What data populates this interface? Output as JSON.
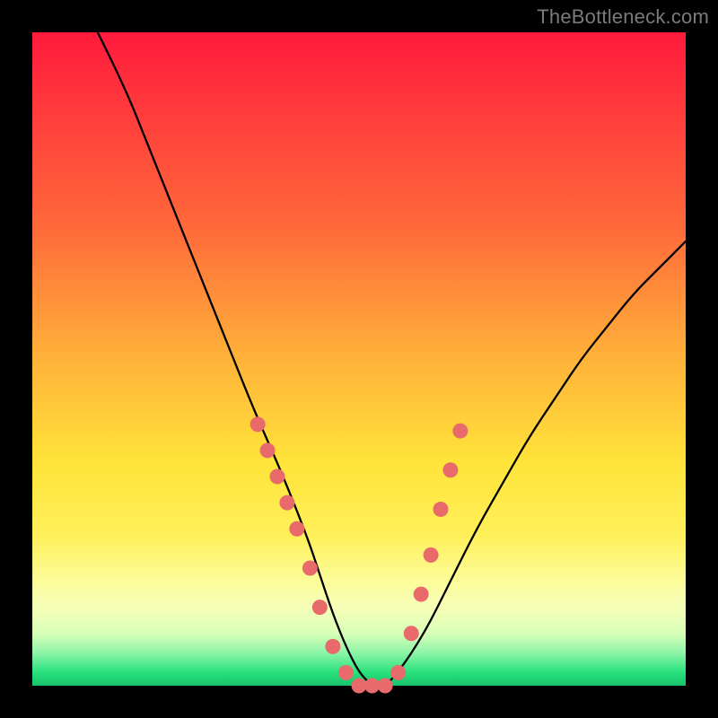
{
  "watermark": {
    "text": "TheBottleneck.com"
  },
  "chart_data": {
    "type": "line",
    "title": "",
    "xlabel": "",
    "ylabel": "",
    "xlim": [
      0,
      100
    ],
    "ylim": [
      0,
      100
    ],
    "series": [
      {
        "name": "bottleneck-curve",
        "x": [
          10,
          14,
          18,
          22,
          26,
          30,
          34,
          38,
          42,
          44,
          46,
          48,
          50,
          52,
          54,
          56,
          60,
          64,
          68,
          72,
          76,
          80,
          84,
          88,
          92,
          96,
          100
        ],
        "y": [
          100,
          92,
          82,
          72,
          62,
          52,
          42,
          33,
          23,
          17,
          11,
          6,
          2,
          0,
          0,
          2,
          8,
          16,
          24,
          31,
          38,
          44,
          50,
          55,
          60,
          64,
          68
        ]
      }
    ],
    "markers": {
      "name": "highlight-points",
      "color": "#e86a6a",
      "x": [
        34.5,
        36,
        37.5,
        39,
        40.5,
        42.5,
        44,
        46,
        48,
        50,
        52,
        54,
        56,
        58,
        59.5,
        61,
        62.5,
        64,
        65.5
      ],
      "y": [
        40,
        36,
        32,
        28,
        24,
        18,
        12,
        6,
        2,
        0,
        0,
        0,
        2,
        8,
        14,
        20,
        27,
        33,
        39
      ]
    },
    "background_gradient": {
      "top": "#ff1a3c",
      "bottom": "#18c26c",
      "meaning": "lower-is-better"
    }
  }
}
